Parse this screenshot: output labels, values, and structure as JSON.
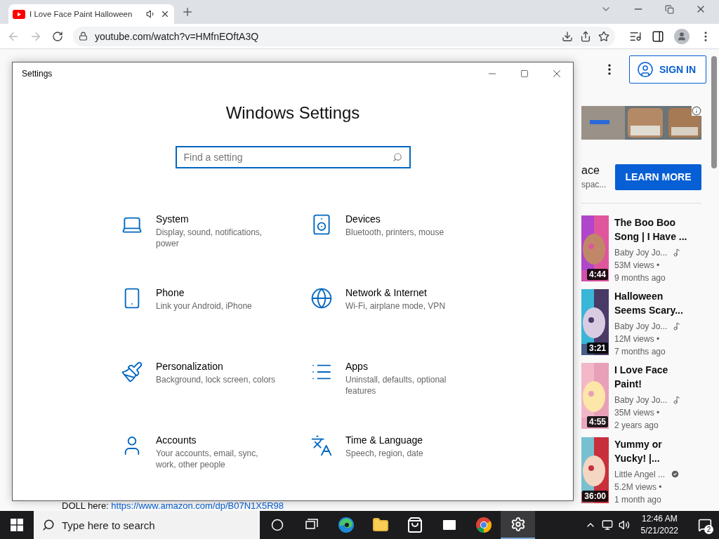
{
  "browser": {
    "tab": {
      "title": "I Love Face Paint Halloween",
      "audio_playing": true
    },
    "address": "youtube.com/watch?v=HMfnEOftA3Q"
  },
  "page": {
    "sign_in": "SIGN IN",
    "ad": {
      "title": "ace",
      "subtitle": "spac...",
      "button": "LEARN MORE"
    },
    "videos": [
      {
        "title": "The Boo Boo\nSong | I Have ...",
        "channel": "Baby Joy Jo...",
        "kind": "music",
        "views": "53M views •",
        "age": "9 months ago",
        "duration": "4:44"
      },
      {
        "title": "Halloween\nSeems Scary...",
        "channel": "Baby Joy Jo...",
        "kind": "music",
        "views": "12M views •",
        "age": "7 months ago",
        "duration": "3:21"
      },
      {
        "title": "I Love Face\nPaint!",
        "channel": "Baby Joy Jo...",
        "kind": "music",
        "views": "35M views •",
        "age": "2 years ago",
        "duration": "4:55"
      },
      {
        "title": "Yummy or\nYucky! |...",
        "channel": "Little Angel ...",
        "kind": "verified",
        "views": "5.2M views •",
        "age": "1 month ago",
        "duration": "36:00"
      }
    ],
    "description": "DOLL here:",
    "link": "https://www.amazon.com/dp/B07N1X5R98"
  },
  "settings_window": {
    "title": "Settings",
    "heading": "Windows Settings",
    "search": {
      "placeholder": "Find a setting"
    },
    "categories": [
      {
        "kind": "system",
        "name": "System",
        "description": "Display, sound, notifications,\npower"
      },
      {
        "kind": "devices",
        "name": "Devices",
        "description": "Bluetooth, printers, mouse"
      },
      {
        "kind": "phone",
        "name": "Phone",
        "description": "Link your Android, iPhone"
      },
      {
        "kind": "network",
        "name": "Network & Internet",
        "description": "Wi-Fi, airplane mode, VPN"
      },
      {
        "kind": "personalization",
        "name": "Personalization",
        "description": "Background, lock screen, colors"
      },
      {
        "kind": "apps",
        "name": "Apps",
        "description": "Uninstall, defaults, optional\nfeatures"
      },
      {
        "kind": "accounts",
        "name": "Accounts",
        "description": "Your accounts, email, sync,\nwork, other people"
      },
      {
        "kind": "time",
        "name": "Time & Language",
        "description": "Speech, region, date"
      }
    ]
  },
  "taskbar": {
    "search_placeholder": "Type here to search",
    "apps": [
      {
        "kind": "cortana",
        "active": false
      },
      {
        "kind": "taskview",
        "active": false
      },
      {
        "kind": "edge",
        "active": false
      },
      {
        "kind": "explorer",
        "active": false
      },
      {
        "kind": "store",
        "active": false
      },
      {
        "kind": "mail",
        "active": false
      },
      {
        "kind": "chrome",
        "active": false
      },
      {
        "kind": "settings",
        "active": true
      }
    ],
    "time": "12:46 AM",
    "date": "5/21/2022",
    "notifications": "2"
  }
}
